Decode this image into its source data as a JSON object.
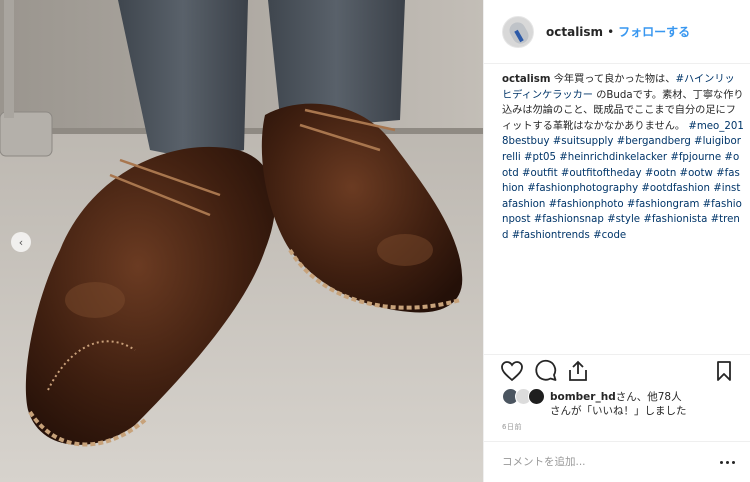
{
  "post": {
    "username": "octalism",
    "separator": "•",
    "follow_label": "フォローする",
    "caption_user": "octalism",
    "caption_text": " 今年買って良かった物は、",
    "caption_tag_heinrich": "#ハインリッヒディンケラッカー",
    "caption_text2": " のBudaです。素材、丁寧な作り込みは勿論のこと、既成品でここまで自分の足にフィットする革靴はなかなかありません。",
    "hashtags": [
      "#meo_2018bestbuy",
      "#suitsupply",
      "#bergandberg",
      "#luigiborrelli",
      "#pt05",
      "#heinrichdinkelacker",
      "#fpjourne",
      "#ootd",
      "#outfit",
      "#outfitoftheday",
      "#ootn",
      "#ootw",
      "#fashion",
      "#fashionphotography",
      "#ootdfashion",
      "#instafashion",
      "#fashionphoto",
      "#fashiongram",
      "#fashionpost",
      "#fashionsnap",
      "#style",
      "#fashionista",
      "#trend",
      "#fashiontrends",
      "#code"
    ],
    "likes_user": "bomber_hd",
    "likes_others": "さん、他78人",
    "likes_suffix": "さんが「いいね！」しました",
    "timestamp": "6日前",
    "comment_placeholder": "コメントを追加...",
    "carousel_arrow": "‹"
  },
  "icons": {
    "like": "heart-icon",
    "comment": "comment-icon",
    "share": "share-icon",
    "save": "bookmark-icon",
    "more": "more-options-icon"
  },
  "colors": {
    "link": "#3897f0",
    "hashtag": "#003569",
    "text": "#262626",
    "muted": "#999999"
  }
}
